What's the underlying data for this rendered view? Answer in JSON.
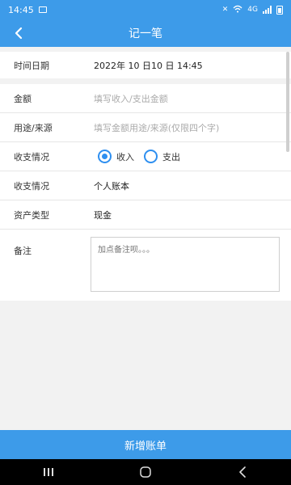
{
  "status_bar": {
    "time": "14:45",
    "right_text": "4G"
  },
  "app_bar": {
    "title": "记一笔"
  },
  "form": {
    "datetime": {
      "label": "时间日期",
      "value": "2022年 10 日10 日  14:45"
    },
    "amount": {
      "label": "金额",
      "placeholder": "填写收入/支出金额"
    },
    "purpose": {
      "label": "用途/来源",
      "placeholder": "填写金额用途/来源(仅限四个字)"
    },
    "type": {
      "label": "收支情况",
      "options": [
        {
          "label": "收入",
          "checked": true
        },
        {
          "label": "支出",
          "checked": false
        }
      ]
    },
    "account": {
      "label": "收支情况",
      "value": "个人账本"
    },
    "asset": {
      "label": "资产类型",
      "value": "现金"
    },
    "note": {
      "label": "备注",
      "placeholder": "加点备注呗。。。"
    }
  },
  "submit_label": "新增账单",
  "colors": {
    "primary": "#3d9be9",
    "radio": "#2e8ff0"
  },
  "nav": {
    "icons": [
      "recent-apps-icon",
      "home-icon",
      "back-icon"
    ]
  }
}
